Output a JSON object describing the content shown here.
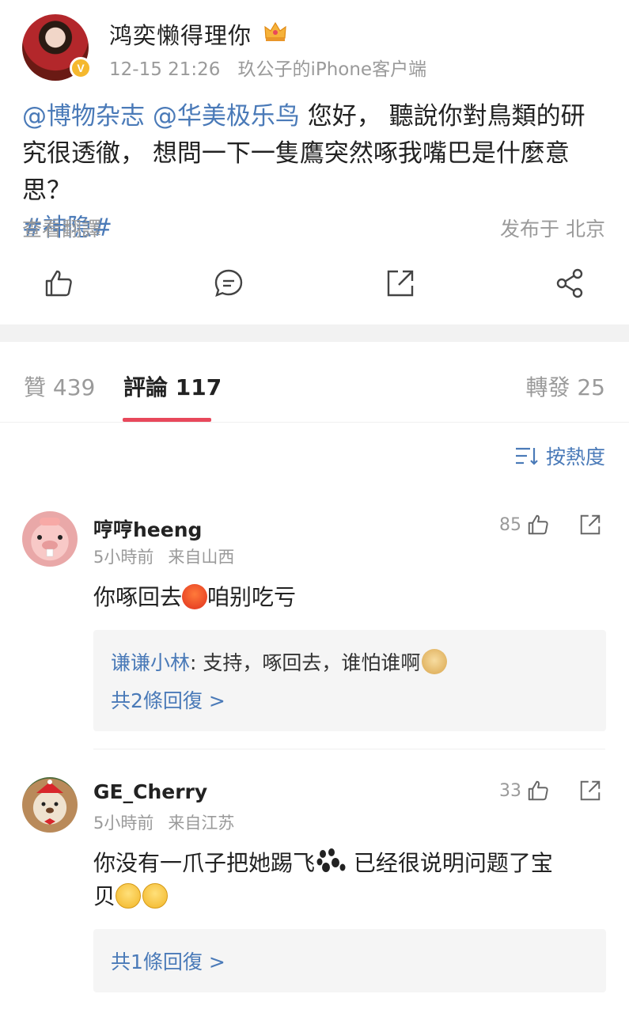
{
  "post": {
    "author": "鸿奕懒得理你",
    "time": "12-15 21:26",
    "source": "玖公子的iPhone客户端",
    "mention1": "@博物杂志",
    "mention2": "@华美极乐鸟",
    "body_line1_rest": " 您好， 聽說你對鳥類的研",
    "body_line2": "究很透徹， 想問一下一隻鷹突然啄我嘴巴是什麼意思？",
    "topic": "#神隐#",
    "translate": "查看翻譯",
    "location": "发布于 北京"
  },
  "tabs": {
    "likes": "贊 439",
    "comments": "評論 117",
    "reposts": "轉發 25"
  },
  "sort": {
    "label": "按熱度"
  },
  "comments": [
    {
      "name": "哼哼heeng",
      "time": "5小時前",
      "location": "来自山西",
      "likes": "85",
      "text_a": "你啄回去",
      "text_b": "咱别吃亏",
      "reply_user": "谦谦小林",
      "reply_text": ": 支持，啄回去，谁怕谁啊",
      "reply_more": "共2條回復 >"
    },
    {
      "name": "GE_Cherry",
      "time": "5小時前",
      "location": "来自江苏",
      "likes": "33",
      "text_a": "你没有一爪子把她踢飞",
      "text_b": " 已经很说明问题了宝",
      "text_c": "贝",
      "reply_more": "共1條回復 >"
    }
  ],
  "icons": {
    "post_actions": [
      "thumbs-up-icon",
      "comment-icon",
      "share-icon",
      "network-share-icon"
    ],
    "accent": "#4a7ab8",
    "tab_indicator": "#e8485b"
  }
}
